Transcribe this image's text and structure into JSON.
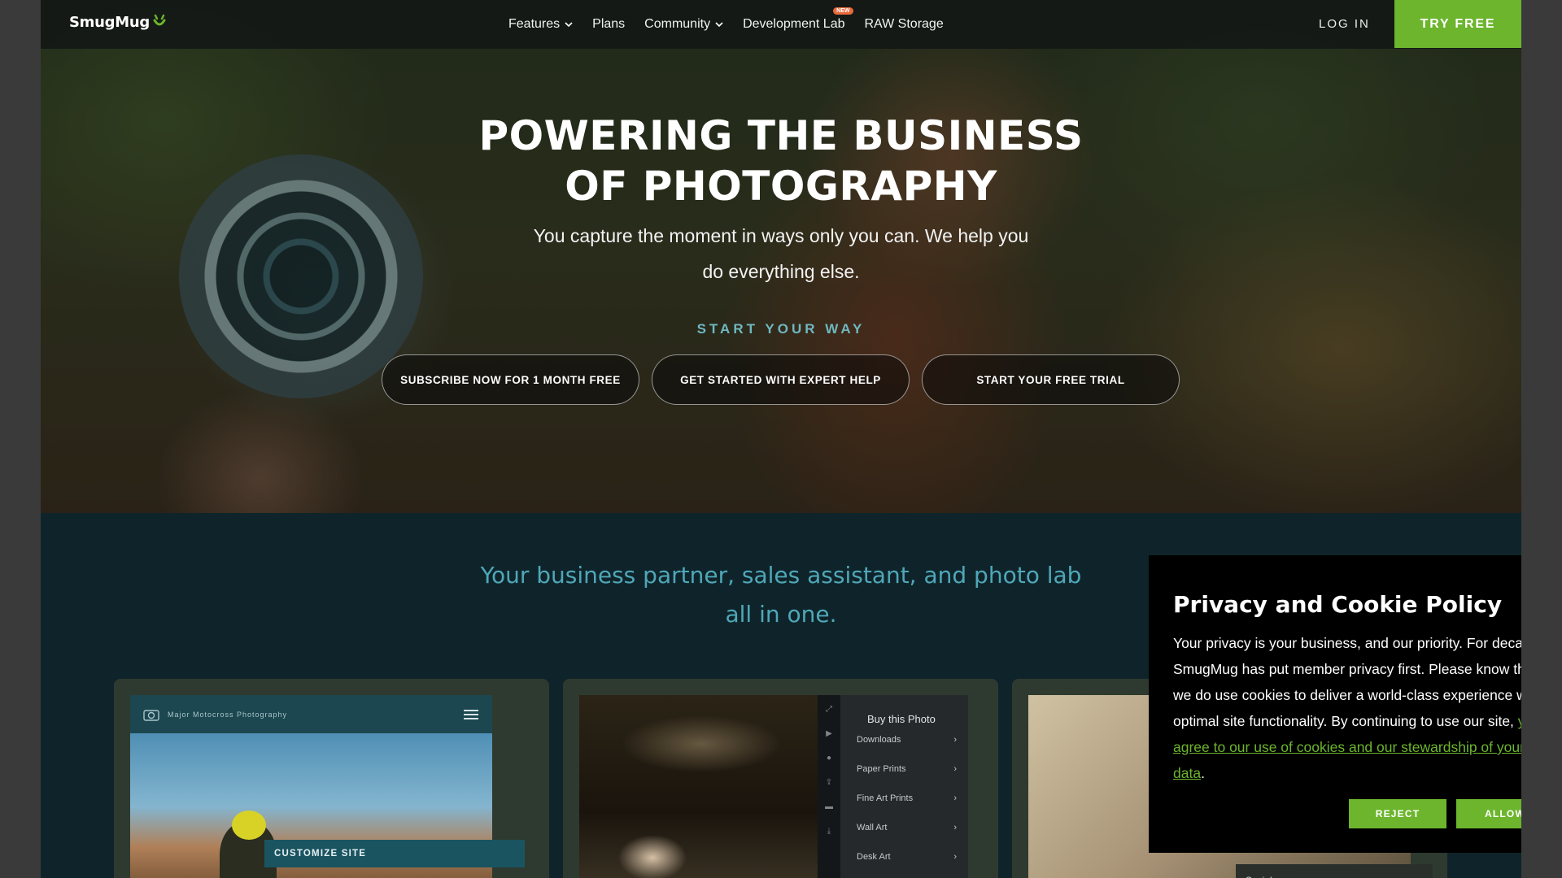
{
  "nav": {
    "logo": "SmugMug",
    "links": [
      {
        "label": "Features",
        "dropdown": true
      },
      {
        "label": "Plans"
      },
      {
        "label": "Community",
        "dropdown": true
      },
      {
        "label": "Development Lab",
        "badge": "NEW"
      },
      {
        "label": "RAW Storage"
      }
    ],
    "login": "LOG IN",
    "try_free": "TRY FREE"
  },
  "hero": {
    "title_line1": "POWERING THE BUSINESS",
    "title_line2": "OF PHOTOGRAPHY",
    "subtitle": "You capture the moment in ways only you can. We help you do everything else.",
    "start_your_way": "START YOUR WAY",
    "ctas": [
      "SUBSCRIBE NOW FOR 1 MONTH FREE",
      "GET STARTED WITH EXPERT HELP",
      "START YOUR FREE TRIAL"
    ]
  },
  "section": {
    "tagline": "Your business partner, sales assistant, and photo lab all in one.",
    "card1": {
      "site_name": "Major Motocross Photography",
      "customize": "CUSTOMIZE SITE"
    },
    "card2": {
      "buy_title": "Buy this Photo",
      "items": [
        "Downloads",
        "Paper Prints",
        "Fine Art Prints",
        "Wall Art",
        "Desk Art"
      ]
    },
    "card3": {
      "social": "Social"
    }
  },
  "cookie": {
    "title": "Privacy and Cookie Policy",
    "body": "Your privacy is your business, and our priority. For decades, SmugMug has put member privacy first. Please know that we do use cookies to deliver a world-class experience with optimal site functionality. By continuing to use our site, ",
    "link": "you agree to our use of cookies and our stewardship of your data",
    "end": ".",
    "reject": "REJECT",
    "allow": "ALLOW"
  },
  "colors": {
    "brand_green": "#6cb52d",
    "teal_accent": "#4fa7b8",
    "section_bg": "#0f242a"
  }
}
